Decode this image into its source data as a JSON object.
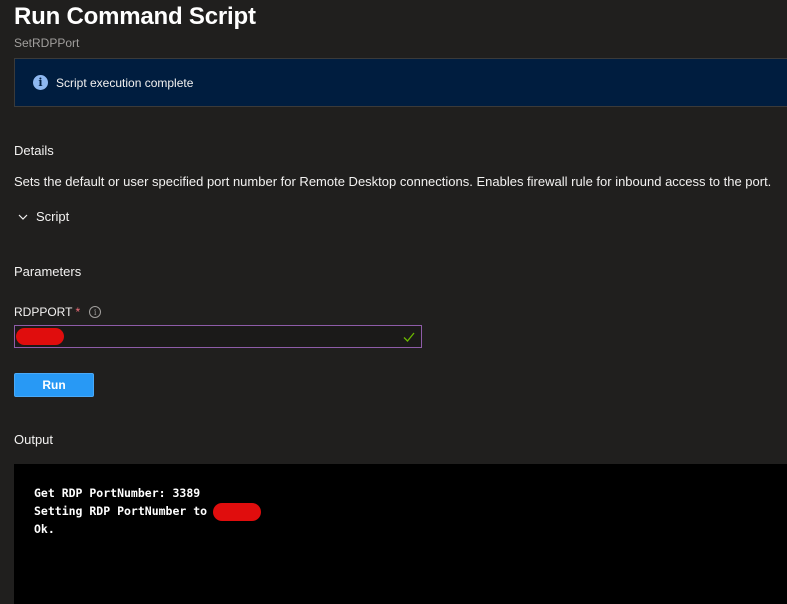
{
  "header": {
    "title": "Run Command Script",
    "subtitle": "SetRDPPort"
  },
  "banner": {
    "icon": "info-icon",
    "message": "Script execution complete",
    "background": "#001d3f"
  },
  "details": {
    "heading": "Details",
    "description": "Sets the default or user specified port number for Remote Desktop connections. Enables firewall rule for inbound access to the port."
  },
  "script_section": {
    "label": "Script",
    "icon": "chevron-down-icon",
    "expanded": false
  },
  "parameters": {
    "heading": "Parameters",
    "field_label": "RDPPORT",
    "required_marker": "*",
    "value_redacted": true,
    "valid": true
  },
  "actions": {
    "run_label": "Run",
    "run_color": "#2899f5"
  },
  "output": {
    "heading": "Output",
    "lines": [
      "Get RDP PortNumber: 3389",
      "Setting RDP PortNumber to",
      "Ok."
    ]
  }
}
